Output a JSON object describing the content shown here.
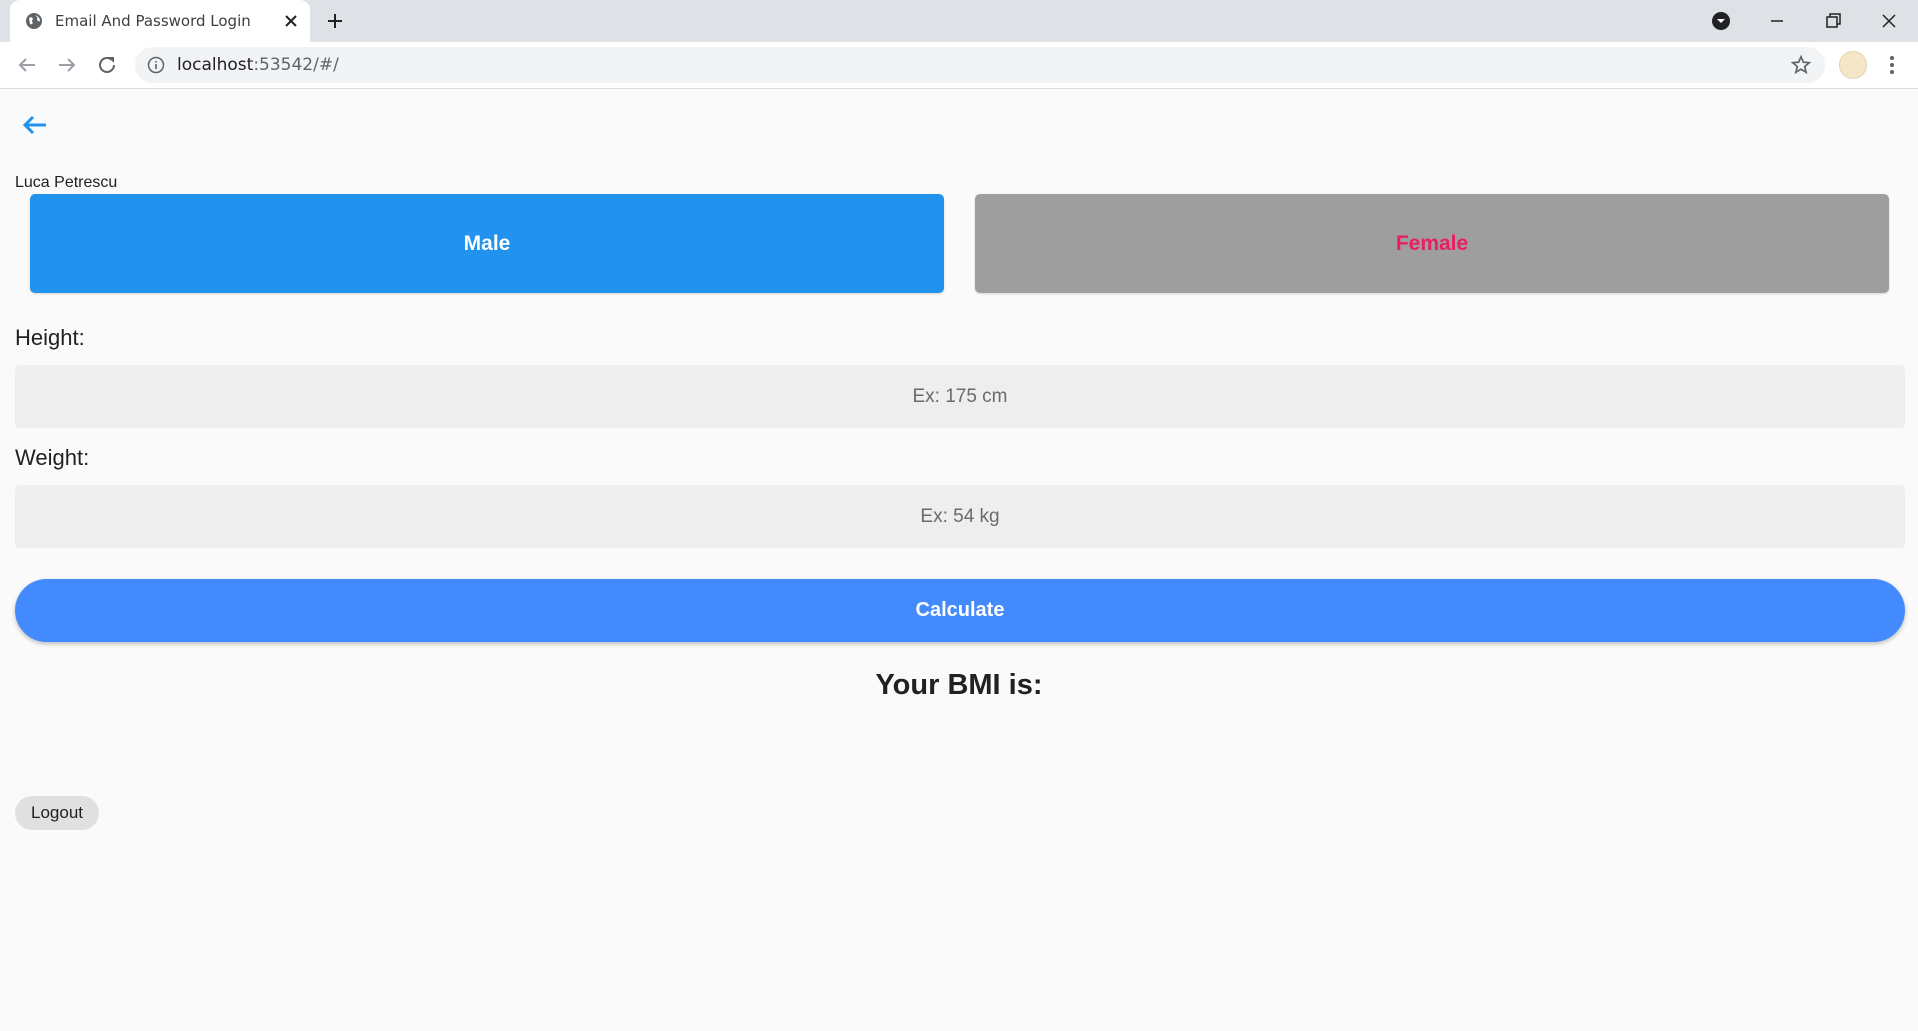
{
  "browser": {
    "tab_title": "Email And Password Login",
    "url_host": "localhost",
    "url_path": ":53542/#/"
  },
  "app": {
    "user_name": "Luca Petrescu",
    "gender": {
      "male_label": "Male",
      "female_label": "Female",
      "selected": "Male"
    },
    "height": {
      "label": "Height:",
      "placeholder": "Ex: 175 cm",
      "value": ""
    },
    "weight": {
      "label": "Weight:",
      "placeholder": "Ex: 54 kg",
      "value": ""
    },
    "calculate_label": "Calculate",
    "result_label": "Your BMI is:",
    "logout_label": "Logout"
  },
  "colors": {
    "male_button": "#2192ee",
    "female_button": "#9e9e9e",
    "female_text": "#e91e63",
    "calculate_button": "#448aff",
    "page_background": "#fafafa"
  },
  "icons": [
    "globe-icon",
    "close-icon",
    "plus-icon",
    "back-arrow-icon",
    "info-icon",
    "star-icon",
    "menu-dots-icon"
  ]
}
